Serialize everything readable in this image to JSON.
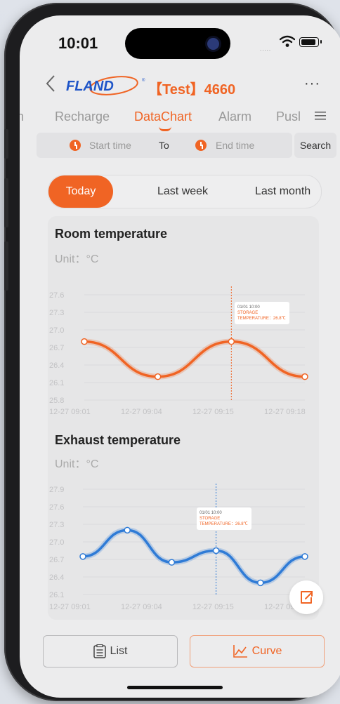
{
  "status_bar": {
    "time": "10:01",
    "signal_dots": "....."
  },
  "header": {
    "device_title": "【Test】4660",
    "more_label": "···"
  },
  "tabs": [
    {
      "label": "h"
    },
    {
      "label": "Recharge"
    },
    {
      "label": "DataChart",
      "active": true
    },
    {
      "label": "Alarm"
    },
    {
      "label": "Pusl"
    }
  ],
  "time_filter": {
    "start_placeholder": "Start time",
    "to_label": "To",
    "end_placeholder": "End time",
    "search_label": "Search"
  },
  "period": {
    "options": [
      "Today",
      "Last week",
      "Last month"
    ],
    "selected": "Today"
  },
  "charts": [
    {
      "title": "Room temperature",
      "unit": "Unit：°C",
      "tooltip": {
        "date": "01/01 10:00",
        "line1": "STORAGE",
        "line2": "TEMPERATURE：26.8℃"
      }
    },
    {
      "title": "Exhaust temperature",
      "unit": "Unit：°C",
      "tooltip": {
        "date": "01/01 10:00",
        "line1": "STORAGE",
        "line2": "TEMPERATURE：26.8℃"
      }
    }
  ],
  "chart_data": [
    {
      "type": "line",
      "title": "Room temperature",
      "ylabel": "Unit：°C",
      "color": "#f06424",
      "y_ticks": [
        "27.6",
        "27.3",
        "27.0",
        "26.7",
        "26.4",
        "26.1",
        "25.8"
      ],
      "ylim": [
        25.8,
        27.6
      ],
      "x_ticks": [
        "12-27 09:01",
        "12-27 09:04",
        "12-27 09:15",
        "12-27 09:18"
      ],
      "x": [
        "12-27 09:01",
        "12-27 09:04",
        "12-27 09:15",
        "12-27 09:18"
      ],
      "values": [
        26.8,
        26.2,
        26.8,
        26.2
      ],
      "highlight_index": 2
    },
    {
      "type": "line",
      "title": "Exhaust temperature",
      "ylabel": "Unit：°C",
      "color": "#2f7bd6",
      "y_ticks": [
        "27.9",
        "27.6",
        "27.3",
        "27.0",
        "26.7",
        "26.4",
        "26.1"
      ],
      "ylim": [
        26.1,
        27.9
      ],
      "x_ticks": [
        "12-27 09:01",
        "12-27 09:04",
        "12-27 09:15",
        "12-27 09:18"
      ],
      "values": [
        26.75,
        27.2,
        26.65,
        26.85,
        26.3,
        26.75
      ],
      "highlight_index": 3
    }
  ],
  "bottom": {
    "list_label": "List",
    "curve_label": "Curve"
  },
  "colors": {
    "accent": "#f06424",
    "blue": "#2f7bd6"
  },
  "icons": {
    "back": "chevron-left-icon",
    "clock": "clock-icon",
    "share": "share-icon",
    "list": "list-icon",
    "curve": "line-chart-icon"
  }
}
